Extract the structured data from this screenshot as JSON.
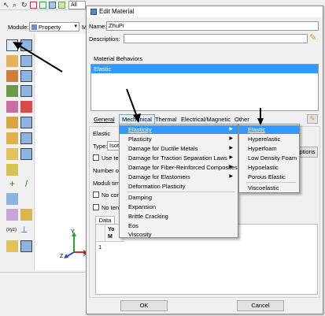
{
  "toolbar": {
    "all_label": "All",
    "icons": [
      "pointer-icon",
      "zoom-icon",
      "rotate-icon",
      "fit-icon",
      "box-zoom-icon",
      "view-icon",
      "grid-icon"
    ]
  },
  "module": {
    "label": "Module:",
    "value": "Property",
    "model_value": "M"
  },
  "left_toolbox": {
    "icons": [
      "create-material-icon",
      "material-manager-icon",
      "create-section-icon",
      "section-manager-icon",
      "assign-section-icon",
      "section-assignment-manager-icon",
      "create-profile-icon",
      "profile-manager-icon",
      "assign-orientation-icon",
      "special-icon",
      "skin-icon",
      "stringer-icon",
      "inertia-icon",
      "inertia-manager-icon",
      "spring-icon",
      "dashpot-icon",
      "edit-icon",
      "attach-icon",
      "datum-axis-icon",
      "datum-plane-icon",
      "partition-face-icon",
      "partition-cell-icon",
      "query-icon",
      "csys-icon",
      "tools-icon",
      "extra-icon"
    ]
  },
  "triad": {
    "x": "X",
    "y": "Y",
    "z": "Z"
  },
  "dialog": {
    "title": "Edit Material",
    "name_label": "Name:",
    "name_value": "ZhuPi",
    "description_label": "Description:",
    "description_value": "",
    "behaviors_group": "Material Behaviors",
    "behaviors": [
      "Elastic"
    ],
    "menubar": [
      "General",
      "Mechanical",
      "Thermal",
      "Electrical/Magnetic",
      "Other"
    ],
    "elastic_group": "Elastic",
    "type_label": "Type:",
    "type_value": "Isotropic",
    "use_temp_label": "Use temperature-dependent data",
    "number_label": "Number of field variables:",
    "moduli_label": "Moduli time scale (for viscoelasticity):",
    "no_compression_label": "No compression",
    "no_tension_label": "No tension",
    "data_tab": "Data",
    "table_header": "Young's Modulus",
    "table_header_short": "Yo\nM",
    "row_number": "1",
    "suboptions_label": "Suboptions",
    "ok_label": "OK",
    "cancel_label": "Cancel"
  },
  "mechanical_menu": [
    "Elasticity",
    "Plasticity",
    "Damage for Ductile Metals",
    "Damage for Traction Separation Laws",
    "Damage for Fiber-Reinforced Composites",
    "Damage for Elastomers",
    "Deformation Plasticity",
    "Damping",
    "Expansion",
    "Brittle Cracking",
    "Eos",
    "Viscosity"
  ],
  "elasticity_submenu": [
    "Elastic",
    "Hyperelastic",
    "Hyperfoam",
    "Low Density Foam",
    "Hypoelastic",
    "Porous Elastic",
    "Viscoelastic"
  ],
  "colors": {
    "accent": "#3399ff",
    "title_bar": "#ffffff",
    "arrow": "#000000"
  }
}
